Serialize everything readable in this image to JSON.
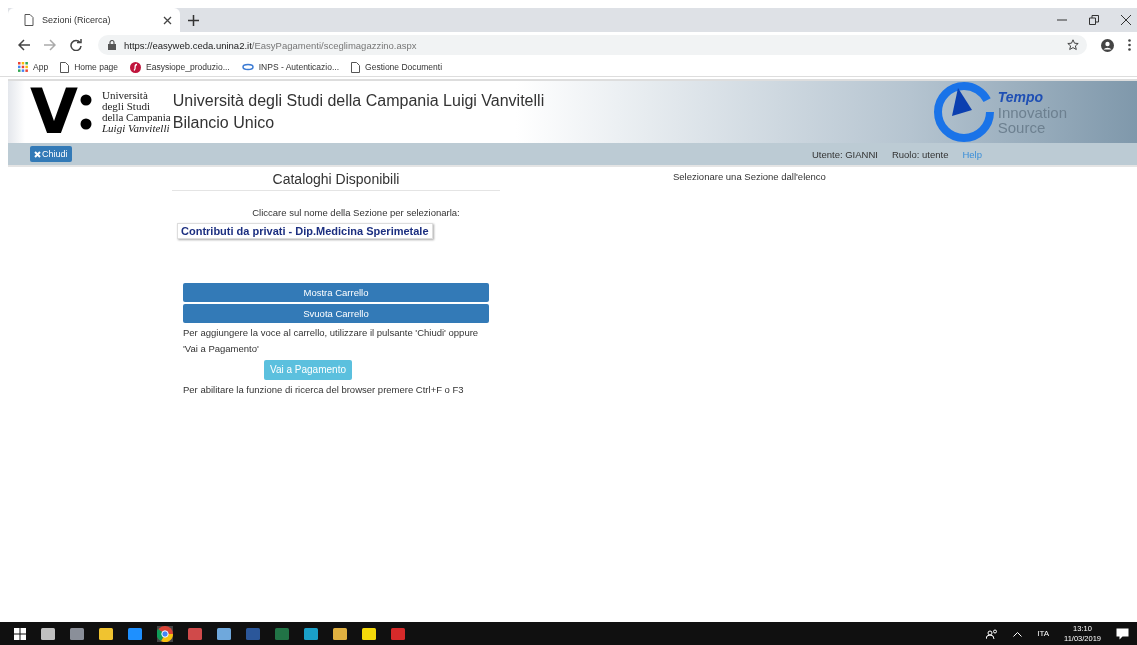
{
  "browser": {
    "tabs": [
      {
        "title": "Sezioni (Ricerca)",
        "selected": true
      }
    ],
    "url": {
      "host": "https://easyweb.ceda.unina2.it",
      "path": "/EasyPagamenti/sceglimagazzino.aspx"
    },
    "bookmarks": [
      {
        "label": "App",
        "kind": "apps"
      },
      {
        "label": "Home page",
        "kind": "page"
      },
      {
        "label": "Easysiope_produzio...",
        "kind": "brand"
      },
      {
        "label": "INPS - Autenticazio...",
        "kind": "ring"
      },
      {
        "label": "Gestione Documenti",
        "kind": "page"
      }
    ]
  },
  "header": {
    "logo": {
      "mark": "V",
      "lines": [
        "Università",
        "degli Studi",
        "della Campania",
        "Luigi Vanvitelli"
      ]
    },
    "title": "Università degli Studi della Campania Luigi Vanvitelli",
    "subtitle": "Bilancio Unico",
    "brand": {
      "name": "Tempo",
      "line2": "Innovation",
      "line3": "Source"
    }
  },
  "navbar": {
    "close_button": "Chiudi",
    "user": "Utente: GIANNI",
    "role": "Ruolo: utente",
    "help": "Help"
  },
  "catalog": {
    "title": "Cataloghi Disponibili",
    "instruction": "Cliccare sul nome della Sezione per selezionarla:",
    "sections": [
      "Contributi da privati - Dip.Medicina Sperimetale"
    ],
    "show_cart": "Mostra Carrello",
    "empty_cart": "Svuota Carrello",
    "note": "Per aggiungere la voce al carrello, utilizzare il pulsante 'Chiudi' oppure 'Vai a Pagamento'",
    "pay_button": "Vai a Pagamento",
    "search_note": "Per abilitare la funzione di ricerca del browser premere Ctrl+F o F3"
  },
  "detail": {
    "message": "Selezionare una Sezione dall'elenco"
  },
  "taskbar": {
    "apps": [
      {
        "kind": "tile",
        "color": "#c0c0c0"
      },
      {
        "kind": "tile",
        "color": "#8a8f99"
      },
      {
        "kind": "tile",
        "color": "#f0c330"
      },
      {
        "kind": "tile",
        "color": "#1e90ff"
      },
      {
        "kind": "chrome",
        "color": "#db4437"
      },
      {
        "kind": "tile",
        "color": "#d04a4a"
      },
      {
        "kind": "tile",
        "color": "#6fa8dc"
      },
      {
        "kind": "tile",
        "color": "#2b579a"
      },
      {
        "kind": "tile",
        "color": "#217346"
      },
      {
        "kind": "tile",
        "color": "#1aa0c8"
      },
      {
        "kind": "tile",
        "color": "#e0b040"
      },
      {
        "kind": "tile",
        "color": "#f5d90a"
      },
      {
        "kind": "tile",
        "color": "#d62a2a"
      }
    ],
    "language": "ITA",
    "time": "13:10",
    "date": "11/03/2019"
  }
}
